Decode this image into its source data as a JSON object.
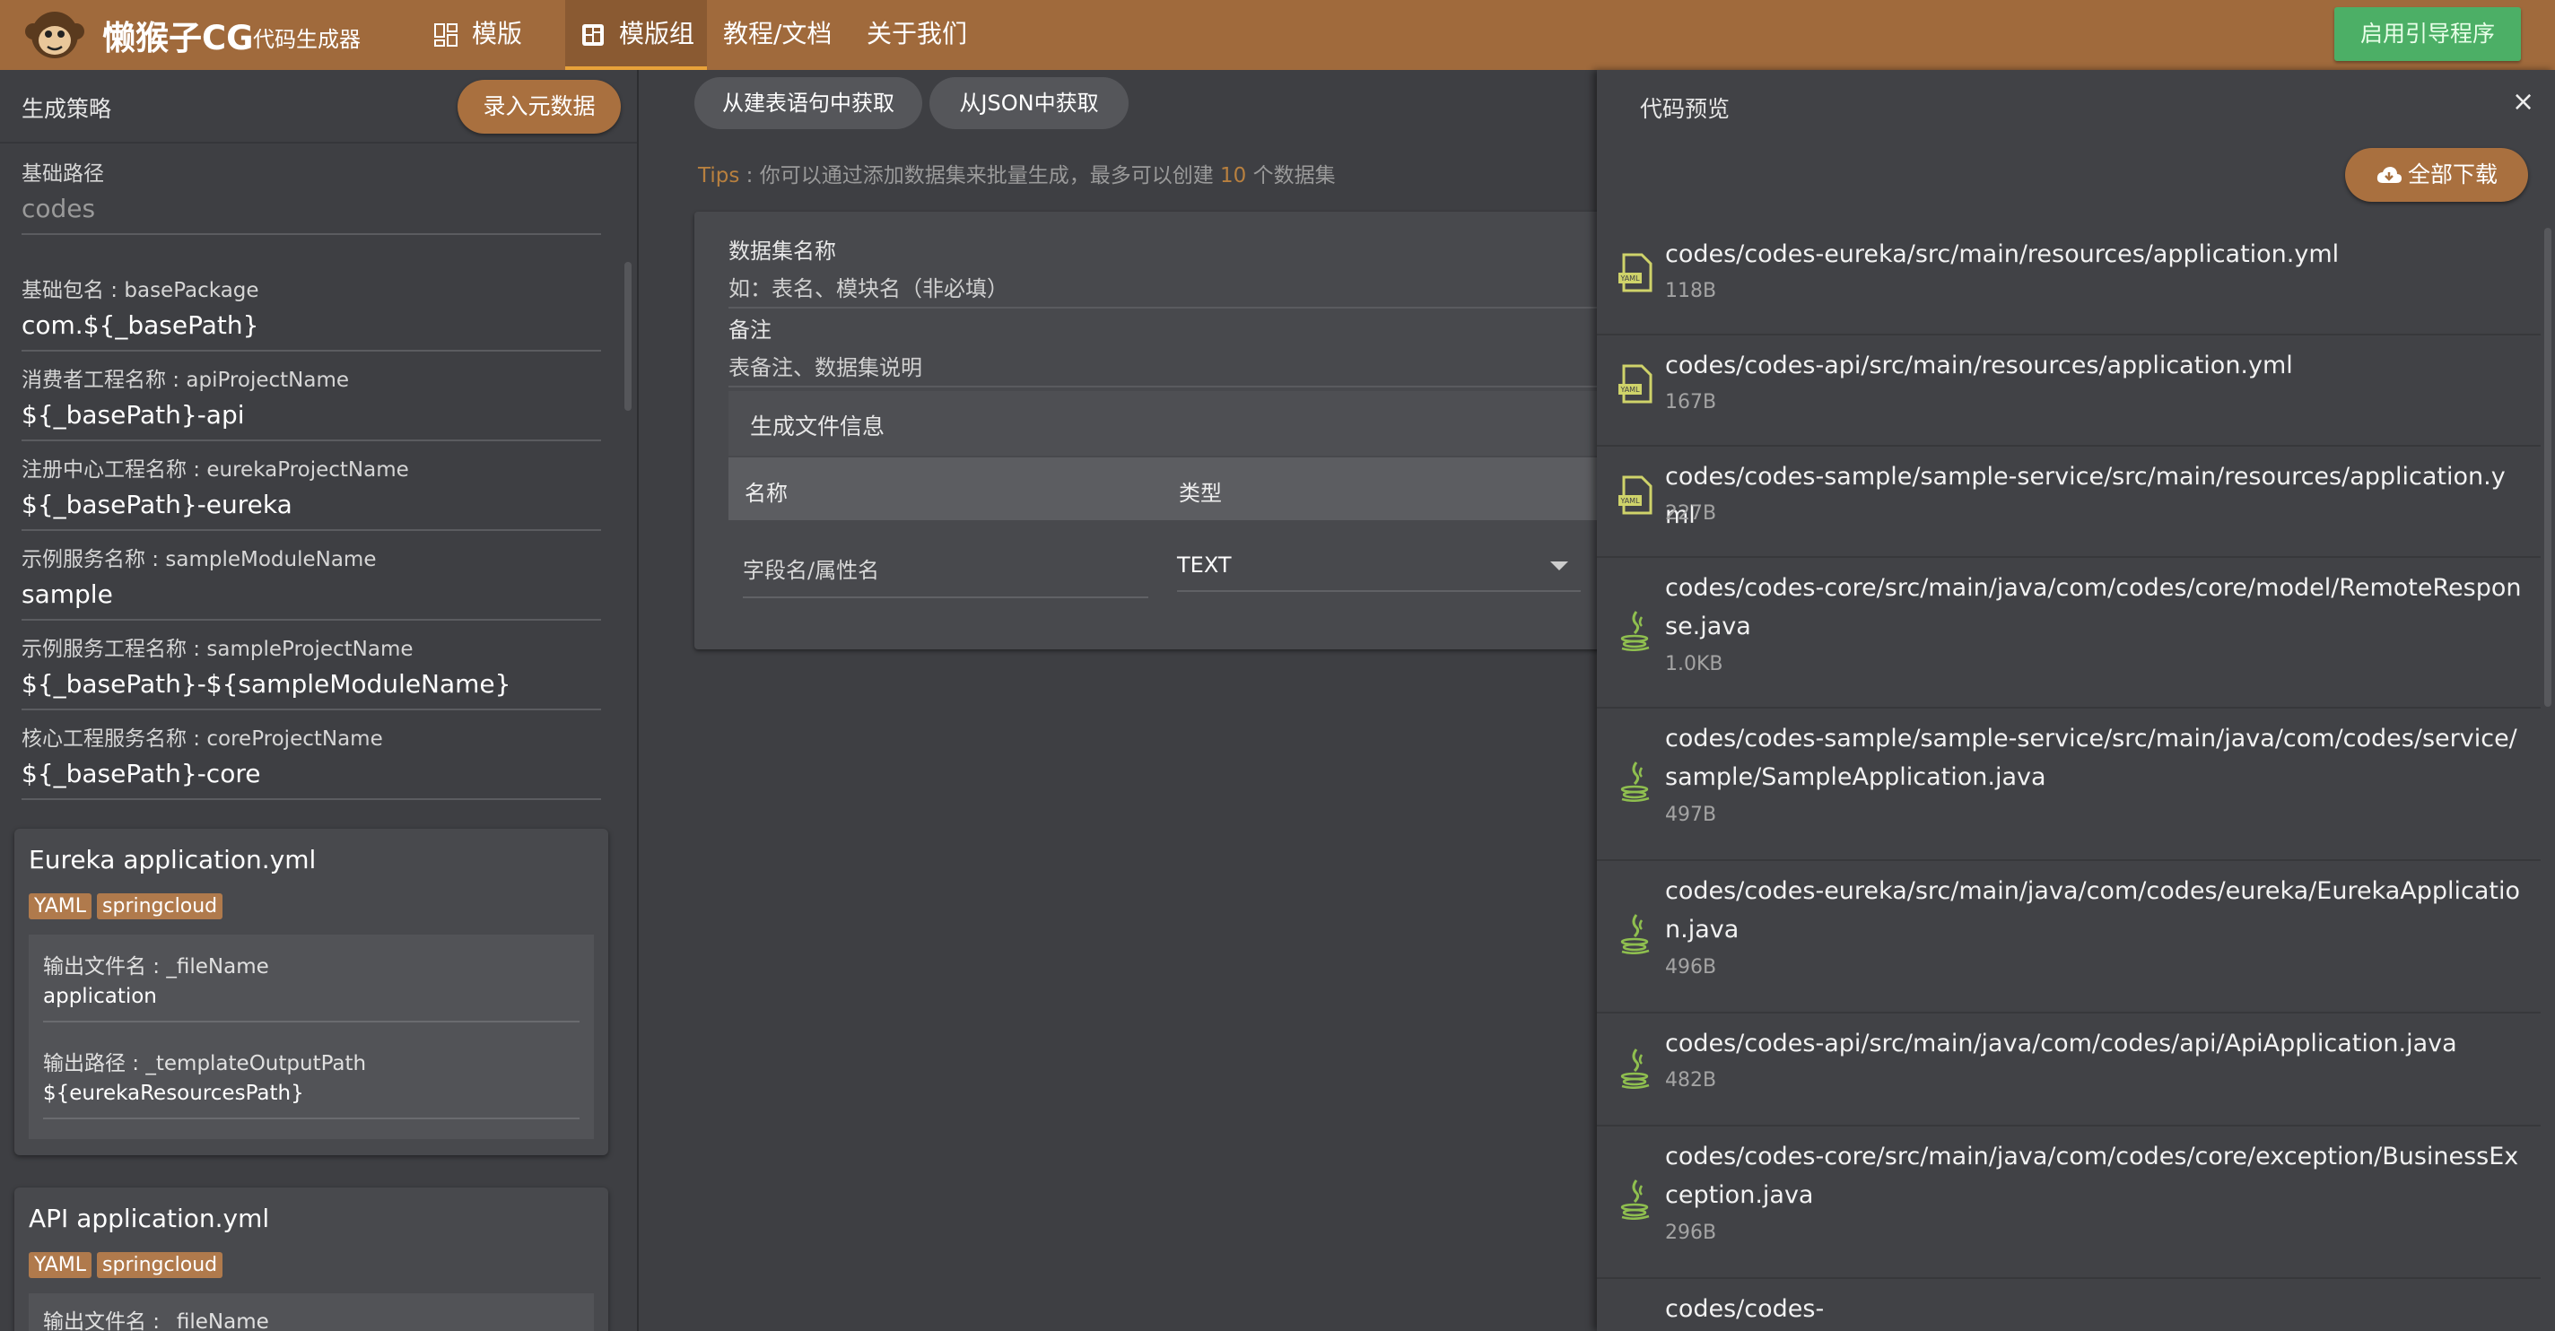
{
  "header": {
    "brand": "懒猴子CG",
    "brand_sub": "代码生成器",
    "nav": [
      {
        "label": "模版",
        "icon": "template-icon"
      },
      {
        "label": "模版组",
        "icon": "template-group-icon"
      },
      {
        "label": "教程/文档"
      },
      {
        "label": "关于我们"
      }
    ],
    "guide_button": "启用引导程序"
  },
  "left": {
    "title": "生成策略",
    "meta_button": "录入元数据",
    "base_path": {
      "label": "基础路径",
      "value": "codes"
    },
    "fields": [
      {
        "label": "基础包名 : basePackage",
        "value": "com.${_basePath}"
      },
      {
        "label": "消费者工程名称 : apiProjectName",
        "value": "${_basePath}-api"
      },
      {
        "label": "注册中心工程名称 : eurekaProjectName",
        "value": "${_basePath}-eureka"
      },
      {
        "label": "示例服务名称 : sampleModuleName",
        "value": "sample"
      },
      {
        "label": "示例服务工程名称 : sampleProjectName",
        "value": "${_basePath}-${sampleModuleName}"
      },
      {
        "label": "核心工程服务名称 : coreProjectName",
        "value": "${_basePath}-core"
      }
    ],
    "templates": [
      {
        "title": "Eureka application.yml",
        "tags": [
          "YAML",
          "springcloud"
        ],
        "fields": [
          {
            "label": "输出文件名 : _fileName",
            "value": "application"
          },
          {
            "label": "输出路径 : _templateOutputPath",
            "value": "${eurekaResourcesPath}"
          }
        ]
      },
      {
        "title": "API application.yml",
        "tags": [
          "YAML",
          "springcloud"
        ],
        "fields": [
          {
            "label": "输出文件名 : _fileName",
            "value": ""
          }
        ]
      }
    ]
  },
  "middle": {
    "buttons": [
      "从建表语句中获取",
      "从JSON中获取"
    ],
    "tips": {
      "prefix": "Tips",
      "text1": " : 你可以通过添加数据集来批量生成，最多可以创建 ",
      "count": "10",
      "text2": " 个数据集"
    },
    "dataset": {
      "name_label": "数据集名称",
      "name_placeholder": "如：表名、模块名（非必填）",
      "remark_label": "备注",
      "remark_placeholder": "表备注、数据集说明",
      "file_info_label": "生成文件信息",
      "columns": [
        "名称",
        "类型"
      ],
      "row": {
        "name_placeholder": "字段名/属性名",
        "type": "TEXT"
      }
    }
  },
  "preview": {
    "title": "代码预览",
    "close": "×",
    "download_button": "全部下载",
    "files": [
      {
        "type": "yaml",
        "path": "codes/codes-eureka/src/main/resources/application.yml",
        "size": "118B"
      },
      {
        "type": "yaml",
        "path": "codes/codes-api/src/main/resources/application.yml",
        "size": "167B"
      },
      {
        "type": "yaml",
        "path": "codes/codes-sample/sample-service/src/main/resources/application.yml",
        "size": "227B"
      },
      {
        "type": "java",
        "path": "codes/codes-core/src/main/java/com/codes/core/model/RemoteResponse.java",
        "size": "1.0KB"
      },
      {
        "type": "java",
        "path": "codes/codes-sample/sample-service/src/main/java/com/codes/service/sample/SampleApplication.java",
        "size": "497B"
      },
      {
        "type": "java",
        "path": "codes/codes-eureka/src/main/java/com/codes/eureka/EurekaApplication.java",
        "size": "496B"
      },
      {
        "type": "java",
        "path": "codes/codes-api/src/main/java/com/codes/api/ApiApplication.java",
        "size": "482B"
      },
      {
        "type": "java",
        "path": "codes/codes-core/src/main/java/com/codes/core/exception/BusinessException.java",
        "size": "296B"
      },
      {
        "type": "java",
        "path": "codes/codes-",
        "size": ""
      }
    ]
  }
}
